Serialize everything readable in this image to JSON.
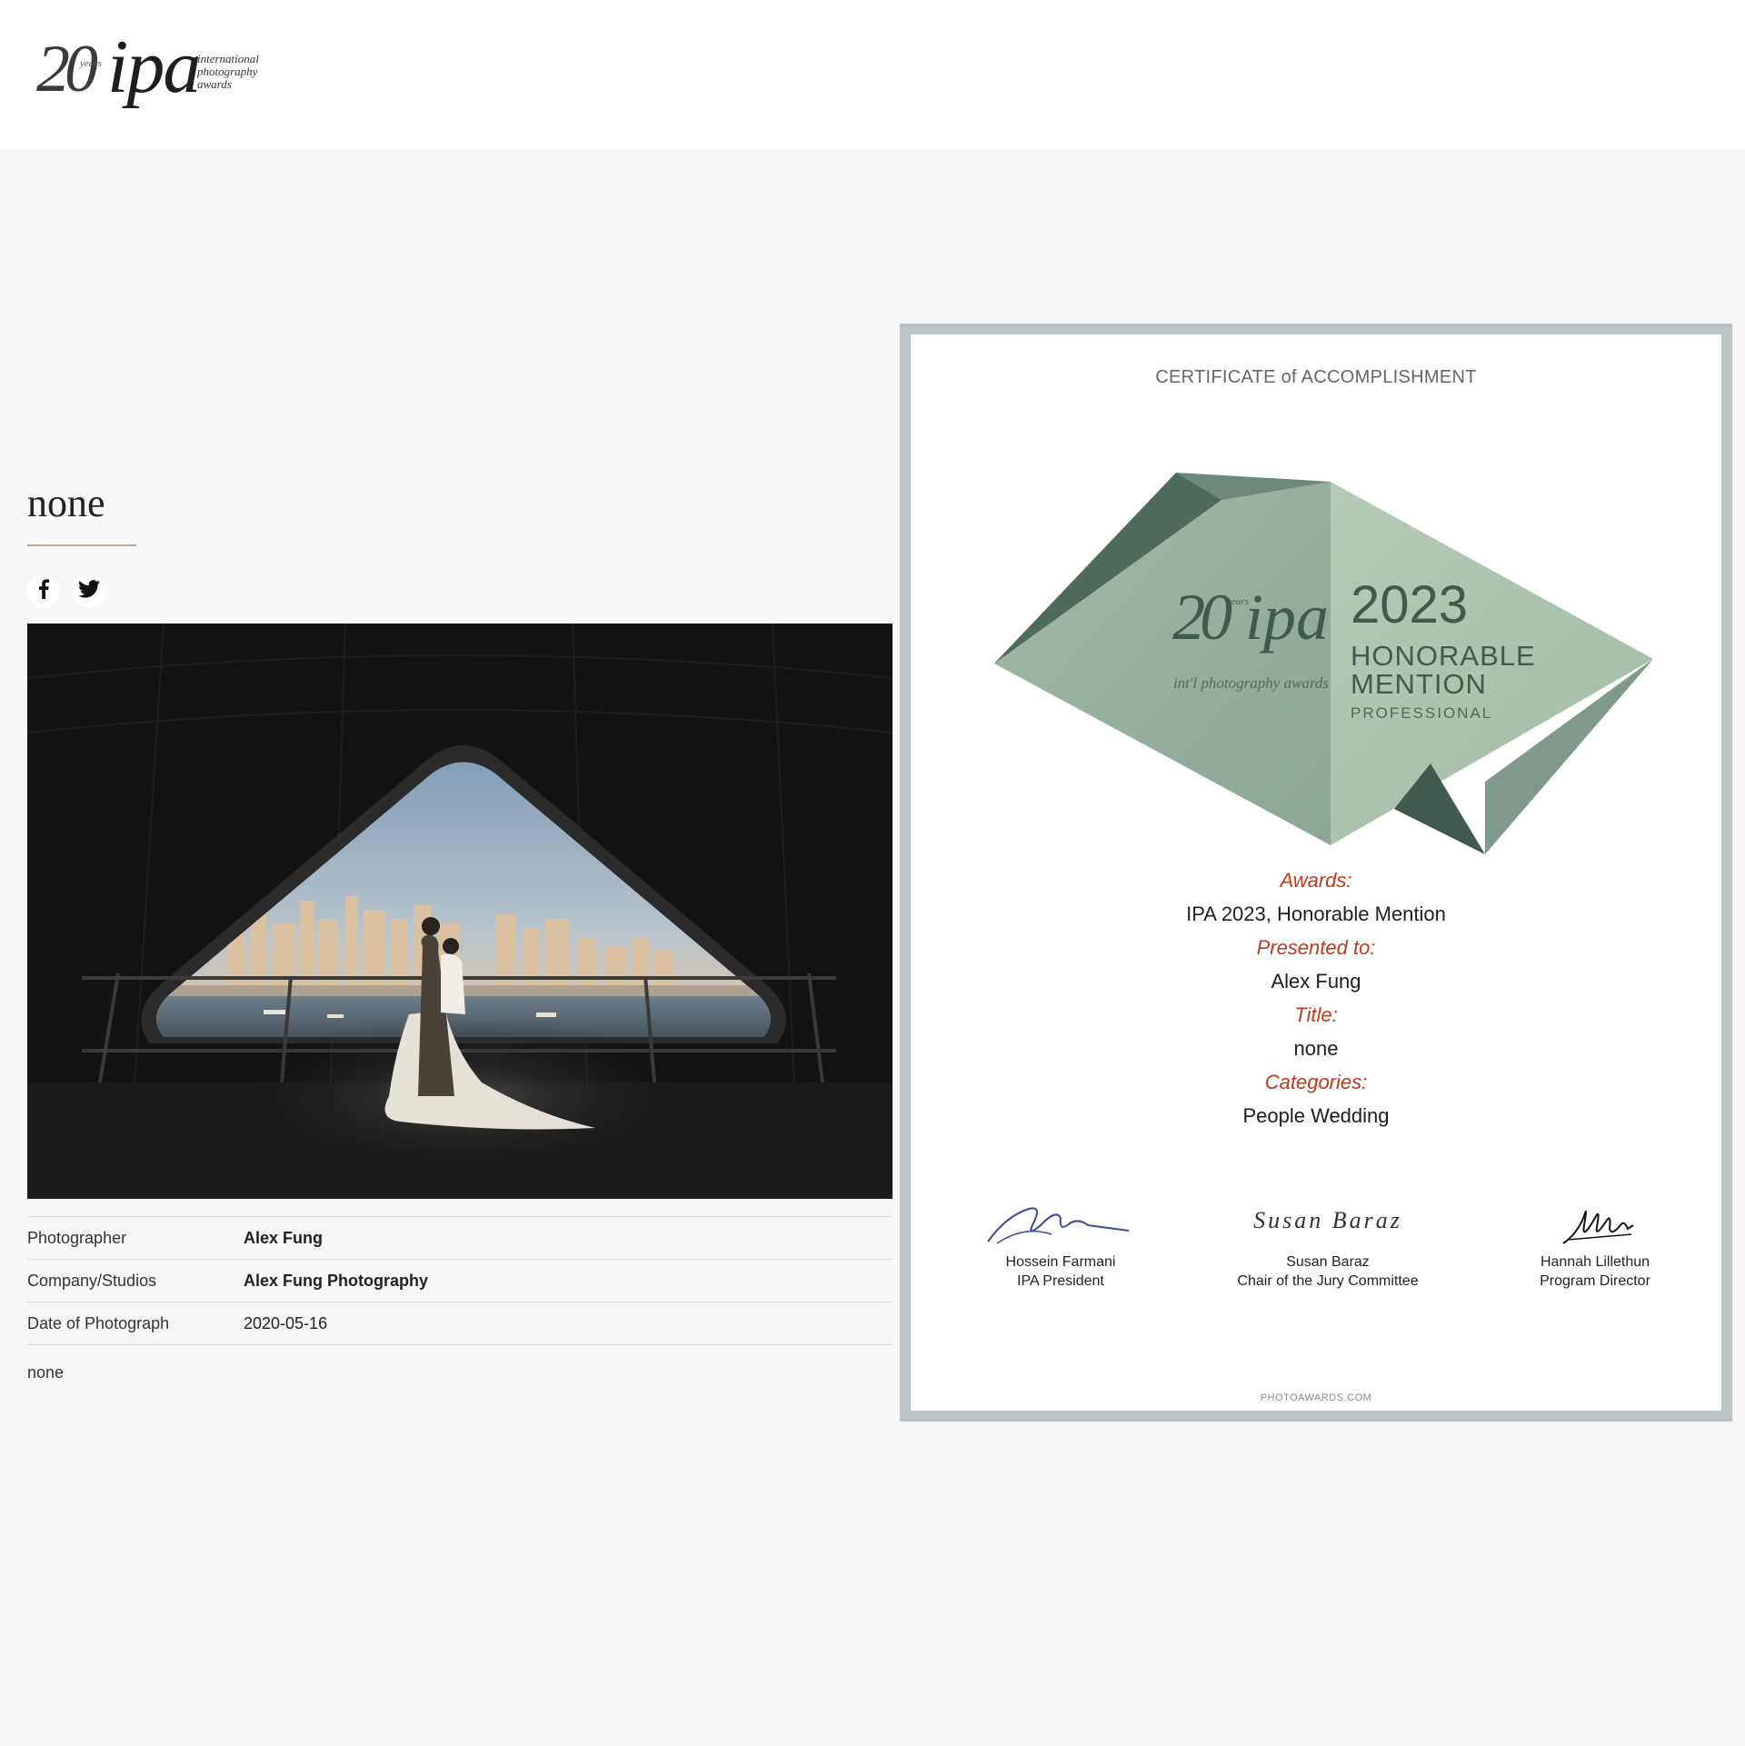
{
  "header": {
    "logo": {
      "number": "20",
      "years": "years",
      "brand": "ipa",
      "tagline": [
        "international",
        "photography",
        "awards"
      ]
    }
  },
  "entry": {
    "title": "none",
    "social": [
      "facebook-icon",
      "twitter-icon"
    ],
    "photographer_label": "Photographer",
    "photographer": "Alex Fung",
    "company_label": "Company/Studios",
    "company": "Alex Fung Photography",
    "date_label": "Date of Photograph",
    "date": "2020-05-16",
    "description": "none"
  },
  "certificate": {
    "heading": "CERTIFICATE of ACCOMPLISHMENT",
    "badge": {
      "number": "20",
      "years": "years",
      "brand": "ipa",
      "tagline": "int'l photography awards",
      "year": "2023",
      "award_line1": "HONORABLE",
      "award_line2": "MENTION",
      "level": "PROFESSIONAL"
    },
    "awards_label": "Awards:",
    "awards": "IPA 2023, Honorable Mention",
    "presented_label": "Presented to:",
    "presented": "Alex Fung",
    "title_label": "Title:",
    "title": "none",
    "categories_label": "Categories:",
    "categories": "People Wedding",
    "signatures": [
      {
        "name": "Hossein Farmani",
        "role": "IPA President"
      },
      {
        "name": "Susan Baraz",
        "role": "Chair of the Jury Committee",
        "script": "Susan Baraz"
      },
      {
        "name": "Hannah Lillethun",
        "role": "Program Director"
      }
    ],
    "footer": "PHOTOAWARDS.COM"
  },
  "colors": {
    "accent": "#c0391b",
    "badge_light": "#a9c2ad",
    "badge_dark": "#3f5b50",
    "frame": "#b9c4c5",
    "rule": "#c7a58a"
  }
}
